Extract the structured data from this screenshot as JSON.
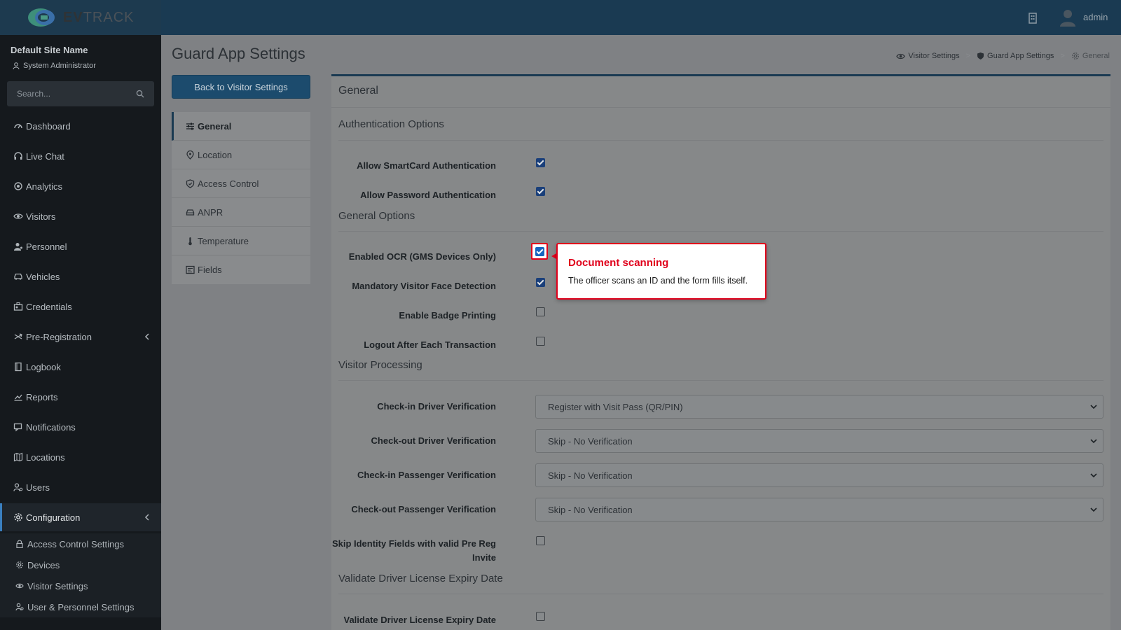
{
  "app": {
    "brand_ev": "EV",
    "brand_track": "TRACK",
    "user_name": "admin"
  },
  "sidebar": {
    "site_name": "Default Site Name",
    "role": "System Administrator",
    "search_placeholder": "Search...",
    "items": [
      {
        "label": "Dashboard",
        "icon": "dashboard-icon"
      },
      {
        "label": "Live Chat",
        "icon": "headset-icon"
      },
      {
        "label": "Analytics",
        "icon": "analytics-icon"
      },
      {
        "label": "Visitors",
        "icon": "eye-icon"
      },
      {
        "label": "Personnel",
        "icon": "personnel-icon"
      },
      {
        "label": "Vehicles",
        "icon": "car-icon"
      },
      {
        "label": "Credentials",
        "icon": "credentials-icon"
      },
      {
        "label": "Pre-Registration",
        "icon": "exchange-icon"
      },
      {
        "label": "Logbook",
        "icon": "book-icon"
      },
      {
        "label": "Reports",
        "icon": "reports-icon"
      },
      {
        "label": "Notifications",
        "icon": "notifications-icon"
      },
      {
        "label": "Locations",
        "icon": "map-icon"
      },
      {
        "label": "Users",
        "icon": "users-icon"
      },
      {
        "label": "Configuration",
        "icon": "gear-icon"
      }
    ],
    "sub_items": [
      {
        "label": "Access Control Settings",
        "icon": "lock-icon"
      },
      {
        "label": "Devices",
        "icon": "cog-icon"
      },
      {
        "label": "Visitor Settings",
        "icon": "eye-icon"
      },
      {
        "label": "User & Personnel Settings",
        "icon": "user-cog-icon"
      }
    ]
  },
  "header": {
    "page_title": "Guard App Settings",
    "breadcrumb": [
      "Visitor Settings",
      "Guard App Settings",
      "General"
    ],
    "back_button": "Back to Visitor Settings"
  },
  "settings_nav": [
    {
      "label": "General",
      "icon": "sliders-icon",
      "active": true
    },
    {
      "label": "Location",
      "icon": "pin-icon",
      "active": false
    },
    {
      "label": "Access Control",
      "icon": "shield-icon",
      "active": false
    },
    {
      "label": "ANPR",
      "icon": "car-icon",
      "active": false
    },
    {
      "label": "Temperature",
      "icon": "thermometer-icon",
      "active": false
    },
    {
      "label": "Fields",
      "icon": "form-icon",
      "active": false
    }
  ],
  "card": {
    "title": "General",
    "sections": {
      "auth": "Authentication Options",
      "general": "General Options",
      "visitor": "Visitor Processing",
      "license": "Validate Driver License Expiry Date"
    },
    "fields": {
      "smartcard": {
        "label": "Allow SmartCard Authentication",
        "checked": true
      },
      "password": {
        "label": "Allow Password Authentication",
        "checked": true
      },
      "ocr": {
        "label": "Enabled OCR (GMS Devices Only)",
        "checked": true
      },
      "face": {
        "label": "Mandatory Visitor Face Detection",
        "checked": true
      },
      "badge": {
        "label": "Enable Badge Printing",
        "checked": false
      },
      "logout": {
        "label": "Logout After Each Transaction",
        "checked": false
      },
      "checkin_driver": {
        "label": "Check-in Driver Verification",
        "value": "Register with Visit Pass (QR/PIN)"
      },
      "checkout_driver": {
        "label": "Check-out Driver Verification",
        "value": "Skip - No Verification"
      },
      "checkin_passenger": {
        "label": "Check-in Passenger Verification",
        "value": "Skip - No Verification"
      },
      "checkout_passenger": {
        "label": "Check-out Passenger Verification",
        "value": "Skip - No Verification"
      },
      "skip_identity": {
        "label_line1": "Skip Identity Fields with valid Pre Reg",
        "label_line2": "Invite",
        "checked": false
      },
      "license_expiry": {
        "label": "Validate Driver License Expiry Date",
        "checked": false
      }
    }
  },
  "tooltip": {
    "title": "Document scanning",
    "body": "The officer scans an ID and the form fills itself."
  },
  "colors": {
    "topbar": "#1a3a52",
    "sidebar": "#15191d",
    "accent": "#1c4b6d",
    "highlight": "#e0001b"
  }
}
